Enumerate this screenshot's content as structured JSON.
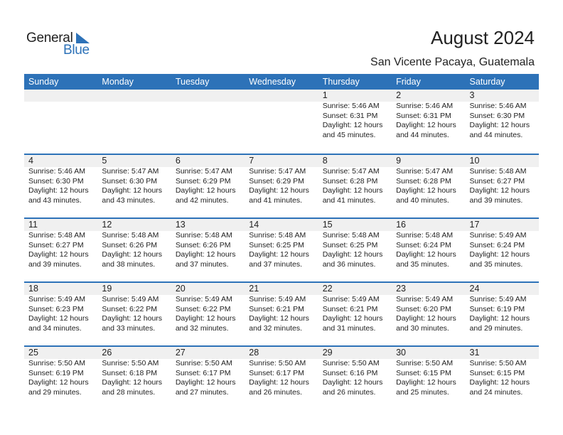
{
  "logo": {
    "general": "General",
    "blue": "Blue"
  },
  "header": {
    "title": "August 2024",
    "location": "San Vicente Pacaya, Guatemala"
  },
  "colors": {
    "accent": "#2d72b8",
    "band": "#f0f0f0"
  },
  "weekdays": [
    "Sunday",
    "Monday",
    "Tuesday",
    "Wednesday",
    "Thursday",
    "Friday",
    "Saturday"
  ],
  "weeks": [
    [
      null,
      null,
      null,
      null,
      {
        "day": "1",
        "sunrise": "Sunrise: 5:46 AM",
        "sunset": "Sunset: 6:31 PM",
        "daylight1": "Daylight: 12 hours",
        "daylight2": "and 45 minutes."
      },
      {
        "day": "2",
        "sunrise": "Sunrise: 5:46 AM",
        "sunset": "Sunset: 6:31 PM",
        "daylight1": "Daylight: 12 hours",
        "daylight2": "and 44 minutes."
      },
      {
        "day": "3",
        "sunrise": "Sunrise: 5:46 AM",
        "sunset": "Sunset: 6:30 PM",
        "daylight1": "Daylight: 12 hours",
        "daylight2": "and 44 minutes."
      }
    ],
    [
      {
        "day": "4",
        "sunrise": "Sunrise: 5:46 AM",
        "sunset": "Sunset: 6:30 PM",
        "daylight1": "Daylight: 12 hours",
        "daylight2": "and 43 minutes."
      },
      {
        "day": "5",
        "sunrise": "Sunrise: 5:47 AM",
        "sunset": "Sunset: 6:30 PM",
        "daylight1": "Daylight: 12 hours",
        "daylight2": "and 43 minutes."
      },
      {
        "day": "6",
        "sunrise": "Sunrise: 5:47 AM",
        "sunset": "Sunset: 6:29 PM",
        "daylight1": "Daylight: 12 hours",
        "daylight2": "and 42 minutes."
      },
      {
        "day": "7",
        "sunrise": "Sunrise: 5:47 AM",
        "sunset": "Sunset: 6:29 PM",
        "daylight1": "Daylight: 12 hours",
        "daylight2": "and 41 minutes."
      },
      {
        "day": "8",
        "sunrise": "Sunrise: 5:47 AM",
        "sunset": "Sunset: 6:28 PM",
        "daylight1": "Daylight: 12 hours",
        "daylight2": "and 41 minutes."
      },
      {
        "day": "9",
        "sunrise": "Sunrise: 5:47 AM",
        "sunset": "Sunset: 6:28 PM",
        "daylight1": "Daylight: 12 hours",
        "daylight2": "and 40 minutes."
      },
      {
        "day": "10",
        "sunrise": "Sunrise: 5:48 AM",
        "sunset": "Sunset: 6:27 PM",
        "daylight1": "Daylight: 12 hours",
        "daylight2": "and 39 minutes."
      }
    ],
    [
      {
        "day": "11",
        "sunrise": "Sunrise: 5:48 AM",
        "sunset": "Sunset: 6:27 PM",
        "daylight1": "Daylight: 12 hours",
        "daylight2": "and 39 minutes."
      },
      {
        "day": "12",
        "sunrise": "Sunrise: 5:48 AM",
        "sunset": "Sunset: 6:26 PM",
        "daylight1": "Daylight: 12 hours",
        "daylight2": "and 38 minutes."
      },
      {
        "day": "13",
        "sunrise": "Sunrise: 5:48 AM",
        "sunset": "Sunset: 6:26 PM",
        "daylight1": "Daylight: 12 hours",
        "daylight2": "and 37 minutes."
      },
      {
        "day": "14",
        "sunrise": "Sunrise: 5:48 AM",
        "sunset": "Sunset: 6:25 PM",
        "daylight1": "Daylight: 12 hours",
        "daylight2": "and 37 minutes."
      },
      {
        "day": "15",
        "sunrise": "Sunrise: 5:48 AM",
        "sunset": "Sunset: 6:25 PM",
        "daylight1": "Daylight: 12 hours",
        "daylight2": "and 36 minutes."
      },
      {
        "day": "16",
        "sunrise": "Sunrise: 5:48 AM",
        "sunset": "Sunset: 6:24 PM",
        "daylight1": "Daylight: 12 hours",
        "daylight2": "and 35 minutes."
      },
      {
        "day": "17",
        "sunrise": "Sunrise: 5:49 AM",
        "sunset": "Sunset: 6:24 PM",
        "daylight1": "Daylight: 12 hours",
        "daylight2": "and 35 minutes."
      }
    ],
    [
      {
        "day": "18",
        "sunrise": "Sunrise: 5:49 AM",
        "sunset": "Sunset: 6:23 PM",
        "daylight1": "Daylight: 12 hours",
        "daylight2": "and 34 minutes."
      },
      {
        "day": "19",
        "sunrise": "Sunrise: 5:49 AM",
        "sunset": "Sunset: 6:22 PM",
        "daylight1": "Daylight: 12 hours",
        "daylight2": "and 33 minutes."
      },
      {
        "day": "20",
        "sunrise": "Sunrise: 5:49 AM",
        "sunset": "Sunset: 6:22 PM",
        "daylight1": "Daylight: 12 hours",
        "daylight2": "and 32 minutes."
      },
      {
        "day": "21",
        "sunrise": "Sunrise: 5:49 AM",
        "sunset": "Sunset: 6:21 PM",
        "daylight1": "Daylight: 12 hours",
        "daylight2": "and 32 minutes."
      },
      {
        "day": "22",
        "sunrise": "Sunrise: 5:49 AM",
        "sunset": "Sunset: 6:21 PM",
        "daylight1": "Daylight: 12 hours",
        "daylight2": "and 31 minutes."
      },
      {
        "day": "23",
        "sunrise": "Sunrise: 5:49 AM",
        "sunset": "Sunset: 6:20 PM",
        "daylight1": "Daylight: 12 hours",
        "daylight2": "and 30 minutes."
      },
      {
        "day": "24",
        "sunrise": "Sunrise: 5:49 AM",
        "sunset": "Sunset: 6:19 PM",
        "daylight1": "Daylight: 12 hours",
        "daylight2": "and 29 minutes."
      }
    ],
    [
      {
        "day": "25",
        "sunrise": "Sunrise: 5:50 AM",
        "sunset": "Sunset: 6:19 PM",
        "daylight1": "Daylight: 12 hours",
        "daylight2": "and 29 minutes."
      },
      {
        "day": "26",
        "sunrise": "Sunrise: 5:50 AM",
        "sunset": "Sunset: 6:18 PM",
        "daylight1": "Daylight: 12 hours",
        "daylight2": "and 28 minutes."
      },
      {
        "day": "27",
        "sunrise": "Sunrise: 5:50 AM",
        "sunset": "Sunset: 6:17 PM",
        "daylight1": "Daylight: 12 hours",
        "daylight2": "and 27 minutes."
      },
      {
        "day": "28",
        "sunrise": "Sunrise: 5:50 AM",
        "sunset": "Sunset: 6:17 PM",
        "daylight1": "Daylight: 12 hours",
        "daylight2": "and 26 minutes."
      },
      {
        "day": "29",
        "sunrise": "Sunrise: 5:50 AM",
        "sunset": "Sunset: 6:16 PM",
        "daylight1": "Daylight: 12 hours",
        "daylight2": "and 26 minutes."
      },
      {
        "day": "30",
        "sunrise": "Sunrise: 5:50 AM",
        "sunset": "Sunset: 6:15 PM",
        "daylight1": "Daylight: 12 hours",
        "daylight2": "and 25 minutes."
      },
      {
        "day": "31",
        "sunrise": "Sunrise: 5:50 AM",
        "sunset": "Sunset: 6:15 PM",
        "daylight1": "Daylight: 12 hours",
        "daylight2": "and 24 minutes."
      }
    ]
  ]
}
